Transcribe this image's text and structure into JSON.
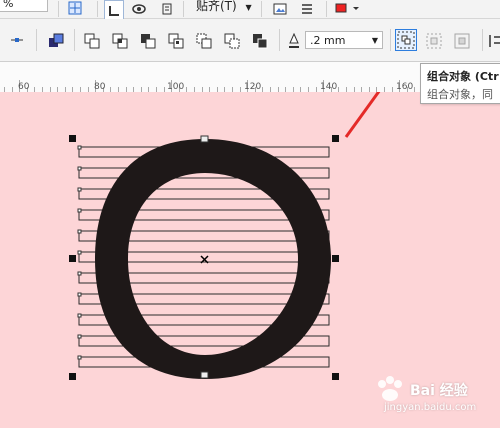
{
  "toolbar1": {
    "percent_text": "%",
    "snap_label": "贴齐(T)"
  },
  "toolbar2": {
    "outline_width": ".2 mm"
  },
  "ruler": {
    "labels": [
      "60",
      "80",
      "100",
      "120",
      "140",
      "160"
    ]
  },
  "tooltip": {
    "title": "组合对象 (Ctr",
    "description": "组合对象，同"
  },
  "watermark": {
    "brand_cn": "Bai 经验",
    "brand_url": "jingyan.baidu.com"
  },
  "colors": {
    "canvas": "#fdd5d7",
    "shape": "#1e1818",
    "accent": "#2d7dde",
    "arrow": "#e42a28"
  },
  "icons": [
    "zoom-icon",
    "view-icon",
    "snap-icon",
    "settings-icon",
    "ungroup-all-icon",
    "group-icon",
    "combine-icon",
    "weld-icon",
    "trim-icon",
    "intersect-icon",
    "simplify-icon",
    "front-minus-back-icon",
    "back-minus-front-icon",
    "outline-pen-icon"
  ]
}
